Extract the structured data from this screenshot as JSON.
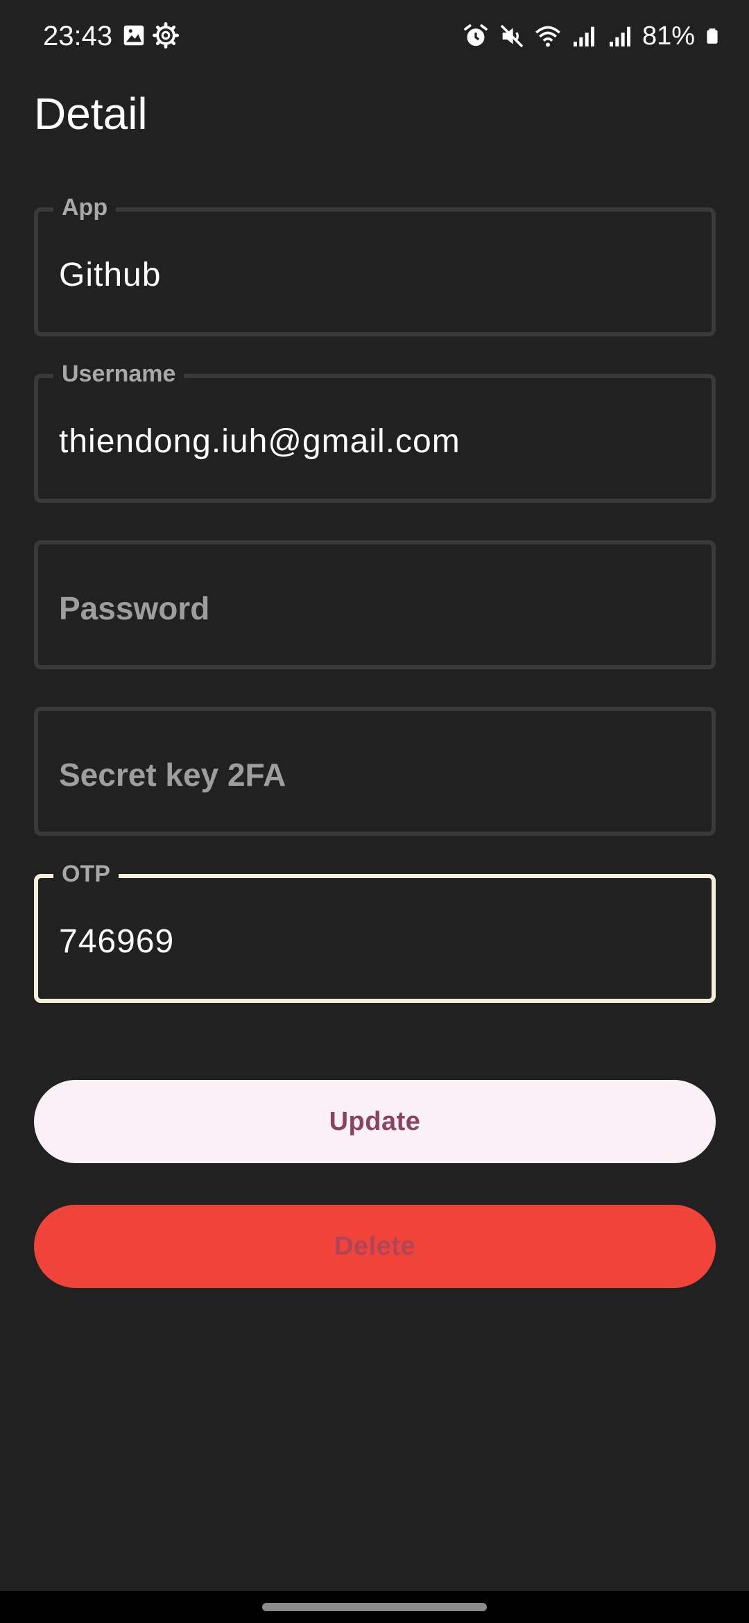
{
  "status_bar": {
    "time": "23:43",
    "battery": "81%",
    "left_icons": [
      "image-icon",
      "settings-gear-icon"
    ],
    "right_icons": [
      "alarm-icon",
      "mute-icon",
      "wifi-icon",
      "signal-icon",
      "signal-icon",
      "battery-icon"
    ]
  },
  "page": {
    "title": "Detail"
  },
  "form": {
    "app": {
      "label": "App",
      "value": "Github"
    },
    "username": {
      "label": "Username",
      "value": "thiendong.iuh@gmail.com"
    },
    "password": {
      "placeholder": "Password"
    },
    "secret": {
      "placeholder": "Secret key 2FA"
    },
    "otp": {
      "label": "OTP",
      "value": "746969"
    }
  },
  "actions": {
    "update_label": "Update",
    "delete_label": "Delete"
  },
  "colors": {
    "background": "#212121",
    "field_border": "#3a3a3a",
    "focused_border": "#f4eedb",
    "update_bg": "#fbf0f5",
    "update_text": "#8a4262",
    "delete_bg": "#f0443b",
    "delete_text": "#b04458"
  }
}
